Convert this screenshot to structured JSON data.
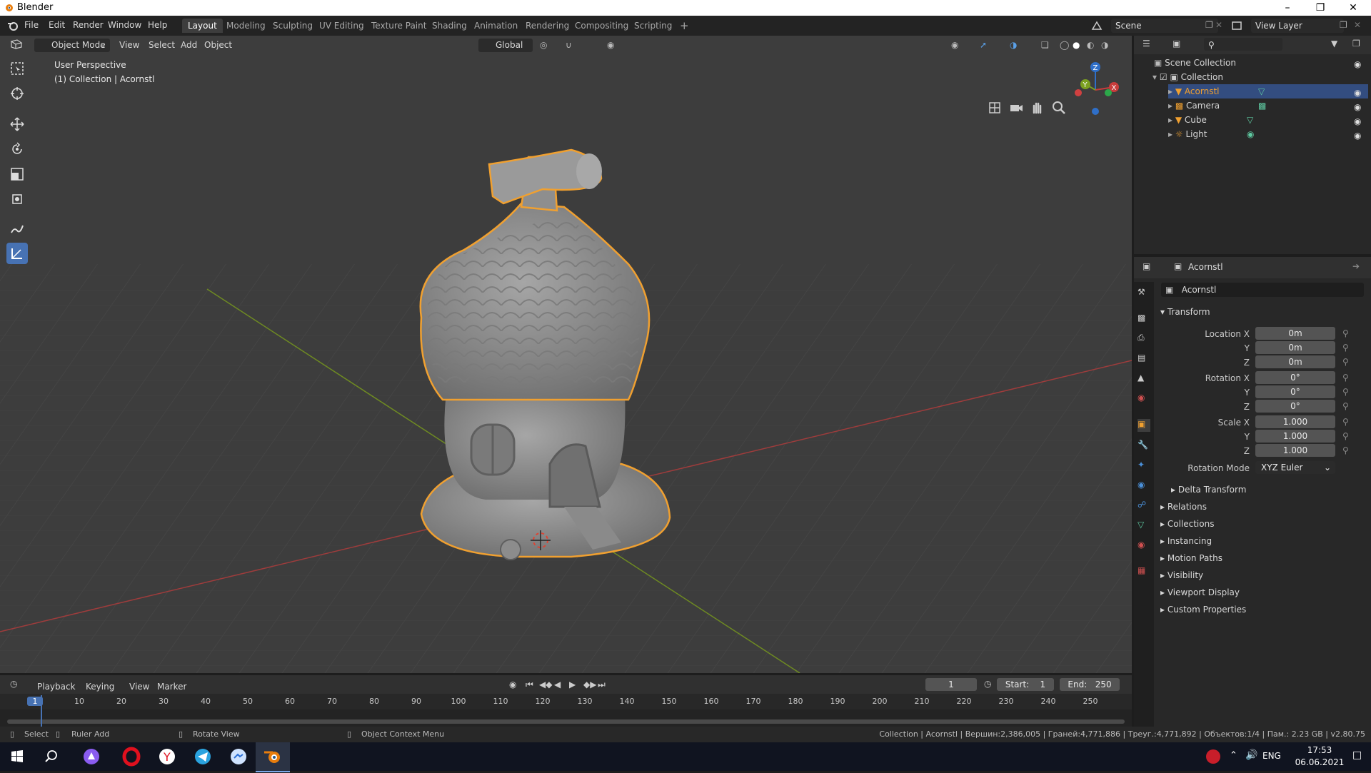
{
  "window": {
    "title": "Blender"
  },
  "menu": {
    "file": "File",
    "edit": "Edit",
    "render": "Render",
    "window": "Window",
    "help": "Help"
  },
  "workspaces": [
    "Layout",
    "Modeling",
    "Sculpting",
    "UV Editing",
    "Texture Paint",
    "Shading",
    "Animation",
    "Rendering",
    "Compositing",
    "Scripting"
  ],
  "scene_field": "Scene",
  "view_layer_field": "View Layer",
  "viewport": {
    "mode": "Object Mode",
    "menus": {
      "view": "View",
      "select": "Select",
      "add": "Add",
      "object": "Object"
    },
    "transform_orientation": "Global",
    "overlay_title": "User Perspective",
    "overlay_sub": "(1) Collection | Acornstl"
  },
  "outliner": {
    "root": "Scene Collection",
    "collection": "Collection",
    "items": [
      {
        "name": "Acornstl",
        "color": "#f0a030"
      },
      {
        "name": "Camera",
        "color": "#d6d6d6"
      },
      {
        "name": "Cube",
        "color": "#d6d6d6"
      },
      {
        "name": "Light",
        "color": "#d6d6d6"
      }
    ]
  },
  "properties": {
    "header_name": "Acornstl",
    "object_name": "Acornstl",
    "transform": {
      "title": "Transform",
      "location_label": "Location X",
      "rotation_label": "Rotation X",
      "scale_label": "Scale X",
      "y": "Y",
      "z": "Z",
      "location": [
        "0m",
        "0m",
        "0m"
      ],
      "rotation": [
        "0°",
        "0°",
        "0°"
      ],
      "scale": [
        "1.000",
        "1.000",
        "1.000"
      ],
      "rotation_mode_label": "Rotation Mode",
      "rotation_mode": "XYZ Euler",
      "delta": "Delta Transform"
    },
    "sections": [
      "Relations",
      "Collections",
      "Instancing",
      "Motion Paths",
      "Visibility",
      "Viewport Display",
      "Custom Properties"
    ]
  },
  "timeline": {
    "menus": {
      "playback": "Playback",
      "keying": "Keying",
      "view": "View",
      "marker": "Marker"
    },
    "current_frame": "1",
    "start_label": "Start:",
    "start": "1",
    "end_label": "End:",
    "end": "250",
    "ticks": [
      "1",
      "10",
      "20",
      "30",
      "40",
      "50",
      "60",
      "70",
      "80",
      "90",
      "100",
      "110",
      "120",
      "130",
      "140",
      "150",
      "160",
      "170",
      "180",
      "190",
      "200",
      "210",
      "220",
      "230",
      "240",
      "250"
    ]
  },
  "status": {
    "select": "Select",
    "ruler": "Ruler Add",
    "rotate": "Rotate View",
    "context": "Object Context Menu",
    "stats": "Collection | Acornstl | Вершин:2,386,005 | Граней:4,771,886 | Треуг.:4,771,892 | Объектов:1/4 | Пам.: 2.23 GB | v2.80.75"
  },
  "taskbar": {
    "lang": "ENG",
    "time": "17:53",
    "date": "06.06.2021"
  },
  "colors": {
    "accent": "#4772b3",
    "selection": "#f0a030",
    "xaxis": "#c83c3c",
    "yaxis": "#7ba020"
  }
}
